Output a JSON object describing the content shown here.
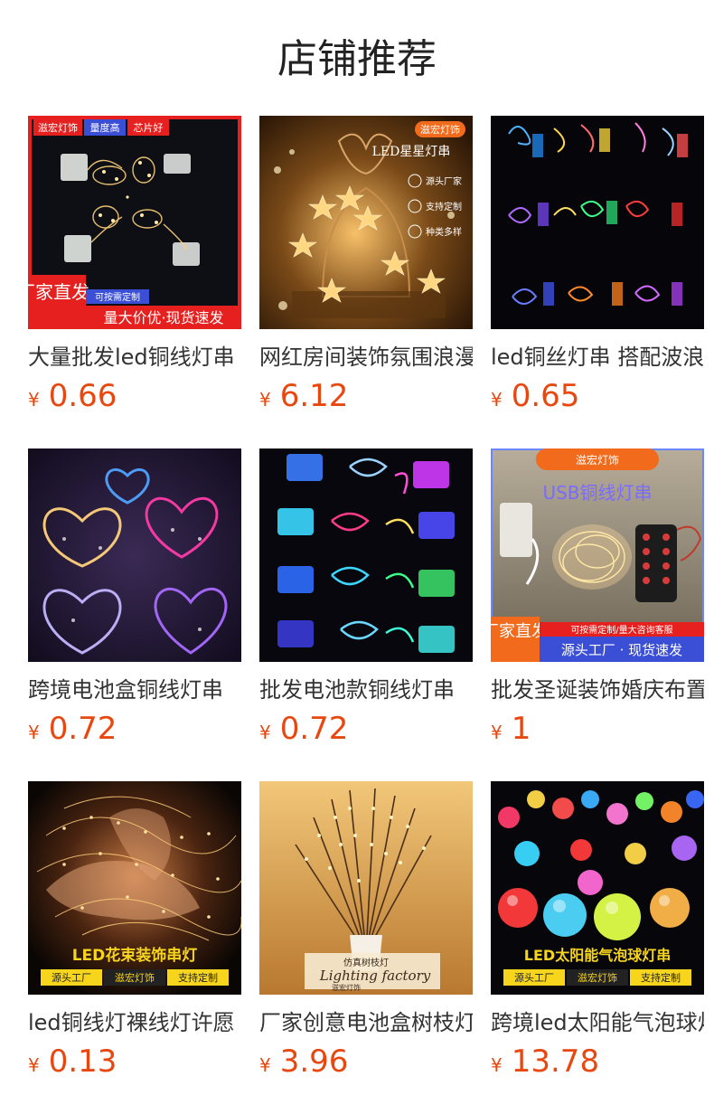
{
  "header": {
    "title": "店铺推荐"
  },
  "currency_symbol": "¥",
  "products": [
    {
      "title": "大量批发led铜线灯串",
      "price": "0.66",
      "image": {
        "tags": [
          "滋宏灯饰",
          "量度高",
          "芯片好"
        ],
        "corner": "厂家直发",
        "note": "可按需定制",
        "banner": "量大价优·现货速发"
      }
    },
    {
      "title": "网红房间装饰氛围浪漫",
      "price": "6.12",
      "image": {
        "brand": "滋宏灯饰",
        "headline": "LED星星灯串",
        "features": [
          "源头厂家",
          "支持定制",
          "种类多样"
        ]
      }
    },
    {
      "title": "led铜丝灯串 搭配波浪",
      "price": "0.65",
      "image": {}
    },
    {
      "title": "跨境电池盒铜线灯串",
      "price": "0.72",
      "image": {}
    },
    {
      "title": "批发电池款铜线灯串",
      "price": "0.72",
      "image": {}
    },
    {
      "title": "批发圣诞装饰婚庆布置",
      "price": "1",
      "image": {
        "brand": "滋宏灯饰",
        "headline": "USB铜线灯串",
        "corner": "厂家直发",
        "note": "可按需定制/量大咨询客服",
        "banner": "源头工厂 · 现货速发"
      }
    },
    {
      "title": "led铜线灯裸线灯许愿",
      "price": "0.13",
      "image": {
        "headline": "LED花束装饰串灯",
        "tags": [
          "源头工厂",
          "滋宏灯饰",
          "支持定制"
        ]
      }
    },
    {
      "title": "厂家创意电池盒树枝灯",
      "price": "3.96",
      "image": {
        "label_cn": "仿真树枝灯",
        "label_en": "Lighting factory",
        "brand": "滋宏灯饰"
      }
    },
    {
      "title": "跨境led太阳能气泡球灯串",
      "price": "13.78",
      "image": {
        "headline": "LED太阳能气泡球灯串",
        "tags": [
          "源头工厂",
          "滋宏灯饰",
          "支持定制"
        ]
      }
    }
  ],
  "colors": {
    "price": "#e8480f",
    "title_text": "#333333",
    "banner_red": "#e6201e",
    "banner_orange": "#f26a1b",
    "tag_yellow": "#f7d51c",
    "warm_light": "#ffd27a"
  }
}
